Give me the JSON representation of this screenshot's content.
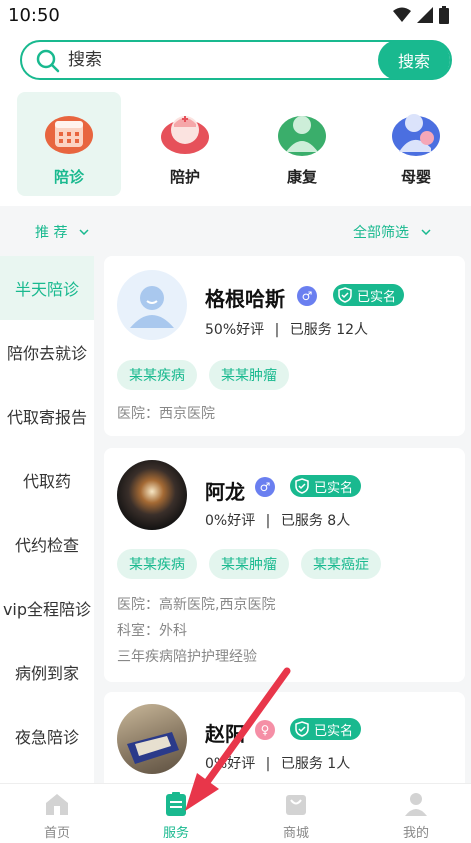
{
  "status_bar": {
    "time": "10:50"
  },
  "search": {
    "placeholder": "搜索",
    "button": "搜索"
  },
  "categories": [
    {
      "label": "陪诊",
      "icon": "calendar-icon",
      "active": true
    },
    {
      "label": "陪护",
      "icon": "nurse-icon",
      "active": false
    },
    {
      "label": "康复",
      "icon": "rehab-person-icon",
      "active": false
    },
    {
      "label": "母婴",
      "icon": "mother-baby-icon",
      "active": false
    }
  ],
  "filters": {
    "left": "推 荐",
    "right": "全部筛选"
  },
  "sidebar": [
    {
      "label": "半天陪诊",
      "active": true
    },
    {
      "label": "陪你去就诊",
      "active": false
    },
    {
      "label": "代取寄报告",
      "active": false
    },
    {
      "label": "代取药",
      "active": false
    },
    {
      "label": "代约检查",
      "active": false
    },
    {
      "label": "vip全程陪诊",
      "active": false
    },
    {
      "label": "病例到家",
      "active": false
    },
    {
      "label": "夜急陪诊",
      "active": false
    }
  ],
  "providers": [
    {
      "name": "格根哈斯",
      "gender": "male",
      "gender_symbol": "♂",
      "verified": "已实名",
      "rating": "50%好评",
      "separator": "|",
      "served": "已服务 12人",
      "tags": [
        "某某疾病",
        "某某肿瘤"
      ],
      "hospital": "医院：西京医院"
    },
    {
      "name": "阿龙",
      "gender": "male",
      "gender_symbol": "♂",
      "verified": "已实名",
      "rating": "0%好评",
      "separator": "|",
      "served": "已服务 8人",
      "tags": [
        "某某疾病",
        "某某肿瘤",
        "某某癌症"
      ],
      "hospital": "医院：高新医院,西京医院",
      "department": "科室：外科",
      "experience": "三年疾病陪护护理经验"
    },
    {
      "name": "赵阳",
      "gender": "female",
      "gender_symbol": "♀",
      "verified": "已实名",
      "rating": "0%好评",
      "separator": "|",
      "served": "已服务 1人"
    }
  ],
  "tabbar": [
    {
      "label": "首页",
      "icon": "home-icon",
      "active": false
    },
    {
      "label": "服务",
      "icon": "service-clipboard-icon",
      "active": true
    },
    {
      "label": "商城",
      "icon": "shopping-bag-icon",
      "active": false
    },
    {
      "label": "我的",
      "icon": "profile-icon",
      "active": false
    }
  ],
  "colors": {
    "accent": "#19b98f",
    "accent_light": "#e9f6f1",
    "male": "#6a7ff0",
    "female": "#f58fa6",
    "arrow": "#e8364a"
  }
}
